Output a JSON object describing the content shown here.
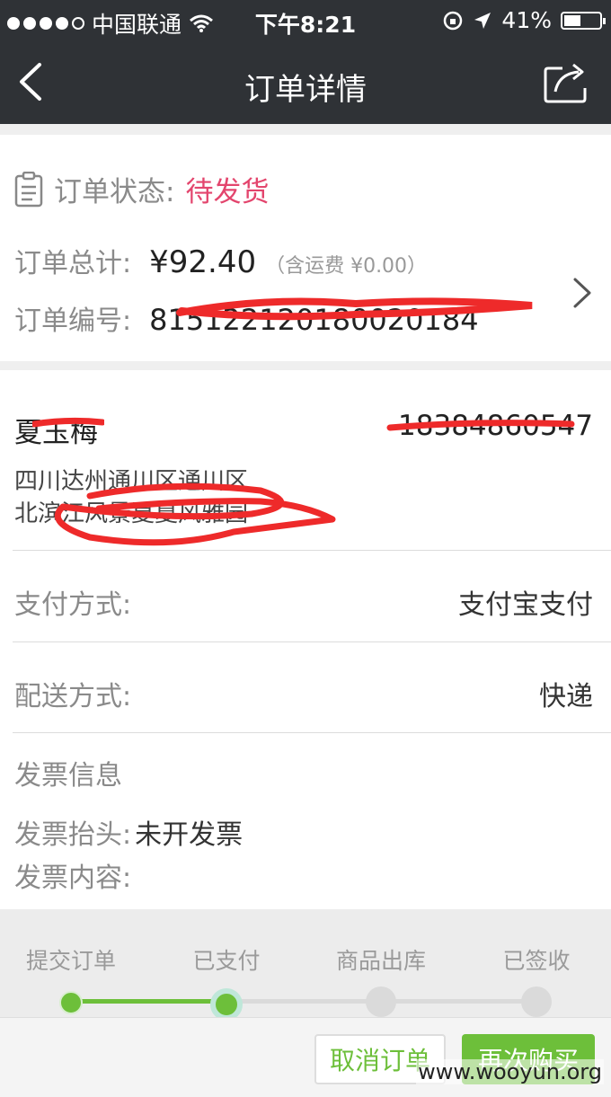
{
  "status_bar": {
    "carrier": "中国联通",
    "time": "下午8:21",
    "battery": "41%"
  },
  "nav": {
    "title": "订单详情",
    "icons": {
      "back": "chevron-left-icon",
      "share": "share-icon"
    }
  },
  "order": {
    "status_label": "订单状态:",
    "status_value": "待发货",
    "total_label": "订单总计:",
    "total_value": "¥92.40",
    "shipping_note": "（含运费 ¥0.00）",
    "number_label": "订单编号:",
    "number_value": "815122120180020184"
  },
  "address": {
    "name": "夏玉梅",
    "phone": "18384860547",
    "line1": "四川达州通川区通川区",
    "line2": "北滨江风景夏夏风雅园"
  },
  "payment": {
    "label": "支付方式:",
    "value": "支付宝支付"
  },
  "delivery": {
    "label": "配送方式:",
    "value": "快递"
  },
  "invoice": {
    "title": "发票信息",
    "header_label": "发票抬头:",
    "header_value": "未开发票",
    "content_label": "发票内容:"
  },
  "progress": {
    "steps": [
      "提交订单",
      "已支付",
      "商品出库",
      "已签收"
    ],
    "completed_steps": 2
  },
  "actions": {
    "cancel": "取消订单",
    "rebuy": "再次购买"
  },
  "watermark": "www.wooyun.org",
  "colors": {
    "accent_green": "#6dbf3a",
    "status_pink": "#e3456d",
    "nav_bg": "#2f3236"
  }
}
